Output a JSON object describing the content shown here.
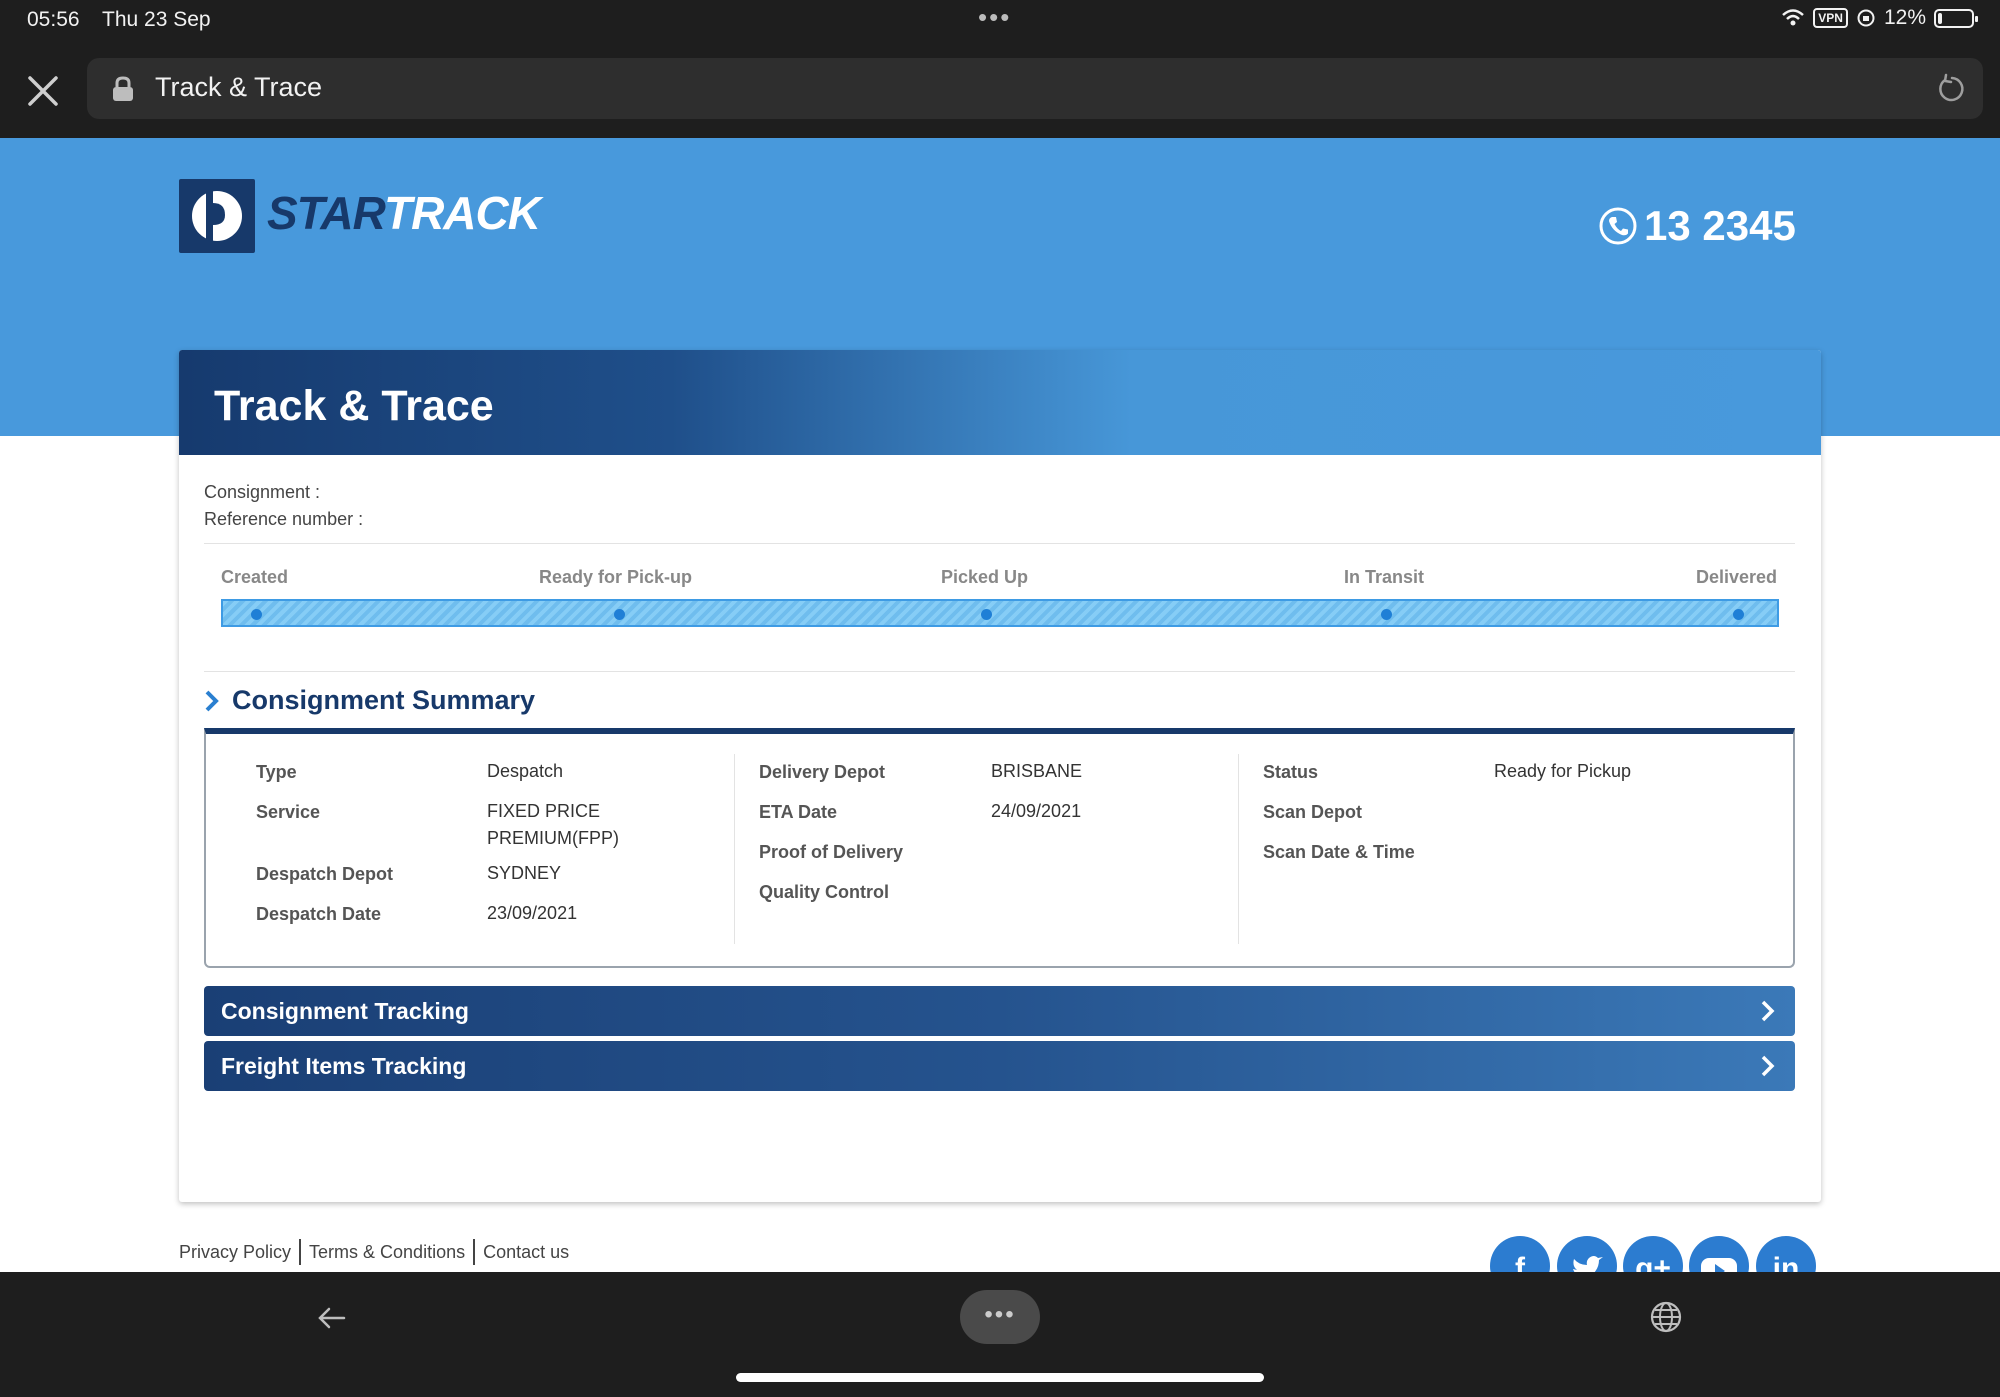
{
  "status_bar": {
    "time": "05:56",
    "date": "Thu 23 Sep",
    "vpn": "VPN",
    "battery": "12%",
    "battery_level": 0.12
  },
  "browser": {
    "title": "Track & Trace"
  },
  "header": {
    "brand_star": "STAR",
    "brand_track": "TRACK",
    "phone": "13 2345"
  },
  "card": {
    "title": "Track & Trace"
  },
  "consignment": {
    "consignment_label": "Consignment :",
    "reference_label": "Reference number :"
  },
  "progress": {
    "steps": [
      "Created",
      "Ready for Pick-up",
      "Picked Up",
      "In Transit",
      "Delivered"
    ]
  },
  "summary": {
    "title": "Consignment Summary",
    "col1": [
      {
        "label": "Type",
        "value": "Despatch"
      },
      {
        "label": "Service",
        "value": "FIXED PRICE PREMIUM(FPP)"
      },
      {
        "label": "Despatch Depot",
        "value": "SYDNEY"
      },
      {
        "label": "Despatch Date",
        "value": "23/09/2021"
      }
    ],
    "col2": [
      {
        "label": "Delivery Depot",
        "value": "BRISBANE"
      },
      {
        "label": "ETA Date",
        "value": "24/09/2021"
      },
      {
        "label": "Proof of Delivery",
        "value": ""
      },
      {
        "label": "Quality Control",
        "value": ""
      }
    ],
    "col3": [
      {
        "label": "Status",
        "value": "Ready for Pickup"
      },
      {
        "label": "Scan Depot",
        "value": ""
      },
      {
        "label": "Scan Date & Time",
        "value": ""
      }
    ]
  },
  "accordions": [
    "Consignment Tracking",
    "Freight Items Tracking"
  ],
  "footer": {
    "links": [
      "Privacy Policy",
      "Terms & Conditions",
      "Contact us"
    ]
  },
  "social": [
    "f",
    "t",
    "g+",
    "yt",
    "in"
  ],
  "colors": {
    "banner": "#4899dc",
    "navy": "#17396a",
    "chrome": "#1e1e1e"
  }
}
